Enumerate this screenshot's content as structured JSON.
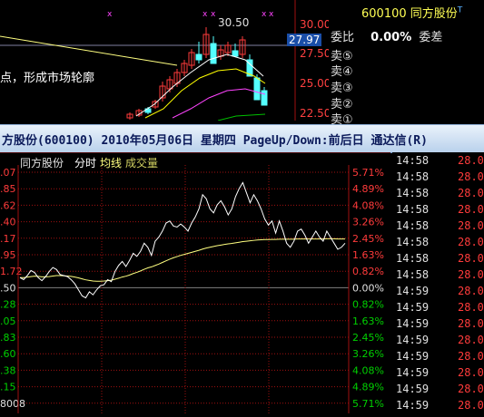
{
  "top_chart": {
    "marker_label": "30.50",
    "annotation": "点，形成市场轮廓",
    "price_labels": [
      "30.00",
      "27.97",
      "27.50",
      "25.00",
      "22.50"
    ],
    "colors": {
      "up": "#ff3b3b",
      "down": "#54ffff",
      "ma1": "#ffffff",
      "ma2": "#ffff00",
      "ma3": "#ff44ff",
      "ma4": "#00c000",
      "axis": "#a01010"
    }
  },
  "quote_panel": {
    "code": "600100",
    "name": "同方股份",
    "mark": "T",
    "weibi_label": "委比",
    "weibi_value": "0.00%",
    "weicha_label": "委差",
    "sell_rows": [
      "卖⑤",
      "卖④",
      "卖③",
      "卖②",
      "卖①"
    ]
  },
  "title_bar": {
    "text": "方股份(600100) 2010年05月06日 星期四 PageUp/Down:前后日 通达信(R)"
  },
  "intraday": {
    "legend_name": "同方股份",
    "legend_time": "分时",
    "legend_avg": "均线",
    "legend_vol": "成交量",
    "left_axis": [
      ".07",
      ".85",
      ".62",
      ".40",
      ".17",
      ".95",
      "1.72",
      ".50",
      ".28",
      ".05",
      ".83",
      ".60",
      ".38",
      ".15",
      "8008"
    ],
    "right_axis": [
      "5.71%",
      "4.89%",
      "4.08%",
      "3.26%",
      "2.45%",
      "1.63%",
      "0.82%",
      "0.00%",
      "0.82%",
      "1.63%",
      "2.45%",
      "3.26%",
      "4.08%",
      "4.89%",
      "5.71%"
    ],
    "colors": {
      "up": "#ff3b3b",
      "down": "#00d000",
      "grid": "#a01010",
      "price": "#ffffff",
      "avg": "#ffff80",
      "zero": "#ffffff"
    },
    "price_series": [
      0.5,
      0.4,
      0.6,
      0.85,
      0.75,
      0.5,
      0.35,
      0.55,
      0.8,
      1.0,
      0.9,
      0.65,
      0.6,
      0.55,
      0.4,
      0.2,
      -0.1,
      -0.4,
      -0.5,
      -0.2,
      -0.35,
      -0.1,
      0.1,
      0.15,
      0.4,
      0.3,
      0.8,
      1.1,
      1.3,
      1.05,
      1.35,
      1.7,
      1.55,
      1.8,
      2.2,
      2.0,
      1.6,
      2.3,
      2.5,
      2.8,
      3.2,
      3.3,
      3.05,
      3.0,
      3.15,
      3.0,
      2.8,
      3.2,
      3.5,
      3.9,
      4.6,
      4.4,
      3.9,
      3.7,
      4.1,
      4.3,
      4.0,
      3.6,
      3.9,
      4.5,
      4.9,
      5.2,
      4.7,
      4.2,
      4.6,
      4.3,
      3.9,
      3.4,
      3.1,
      3.3,
      2.7,
      3.3,
      2.8,
      2.2,
      2.0,
      2.3,
      2.8,
      2.9,
      2.6,
      2.2,
      2.5,
      2.8,
      2.5,
      2.3,
      2.8,
      2.5,
      2.2,
      1.9,
      2.0,
      2.2
    ],
    "avg_series": [
      0.5,
      0.5,
      0.52,
      0.55,
      0.57,
      0.56,
      0.54,
      0.54,
      0.55,
      0.58,
      0.6,
      0.6,
      0.59,
      0.58,
      0.56,
      0.53,
      0.49,
      0.44,
      0.39,
      0.36,
      0.33,
      0.32,
      0.32,
      0.33,
      0.35,
      0.37,
      0.42,
      0.47,
      0.53,
      0.57,
      0.63,
      0.7,
      0.76,
      0.83,
      0.91,
      0.98,
      1.03,
      1.1,
      1.17,
      1.25,
      1.33,
      1.41,
      1.48,
      1.54,
      1.6,
      1.65,
      1.7,
      1.75,
      1.8,
      1.85,
      1.91,
      1.96,
      2.0,
      2.04,
      2.08,
      2.11,
      2.14,
      2.17,
      2.19,
      2.22,
      2.25,
      2.28,
      2.3,
      2.32,
      2.34,
      2.36,
      2.37,
      2.38,
      2.38,
      2.39,
      2.39,
      2.4,
      2.4,
      2.4,
      2.4,
      2.4,
      2.41,
      2.41,
      2.41,
      2.41,
      2.41,
      2.41,
      2.41,
      2.41,
      2.42,
      2.42,
      2.42,
      2.41,
      2.41,
      2.41
    ]
  },
  "ticks": {
    "times": [
      "14:58",
      "14:58",
      "14:58",
      "14:58",
      "14:58",
      "14:58",
      "14:58",
      "14:58",
      "14:59",
      "14:59",
      "14:59",
      "14:59",
      "14:59",
      "14:59",
      "14:59",
      "14:59"
    ],
    "prices": [
      "28.0",
      "28.0",
      "28.0",
      "28.0",
      "28.0",
      "28.0",
      "28.0",
      "28.0",
      "28.0",
      "28.0",
      "28.0",
      "28.0",
      "28.0",
      "28.0",
      "28.0",
      "28.0"
    ],
    "colors": {
      "time": "#e0e0e0",
      "price": "#ff3b3b"
    }
  }
}
